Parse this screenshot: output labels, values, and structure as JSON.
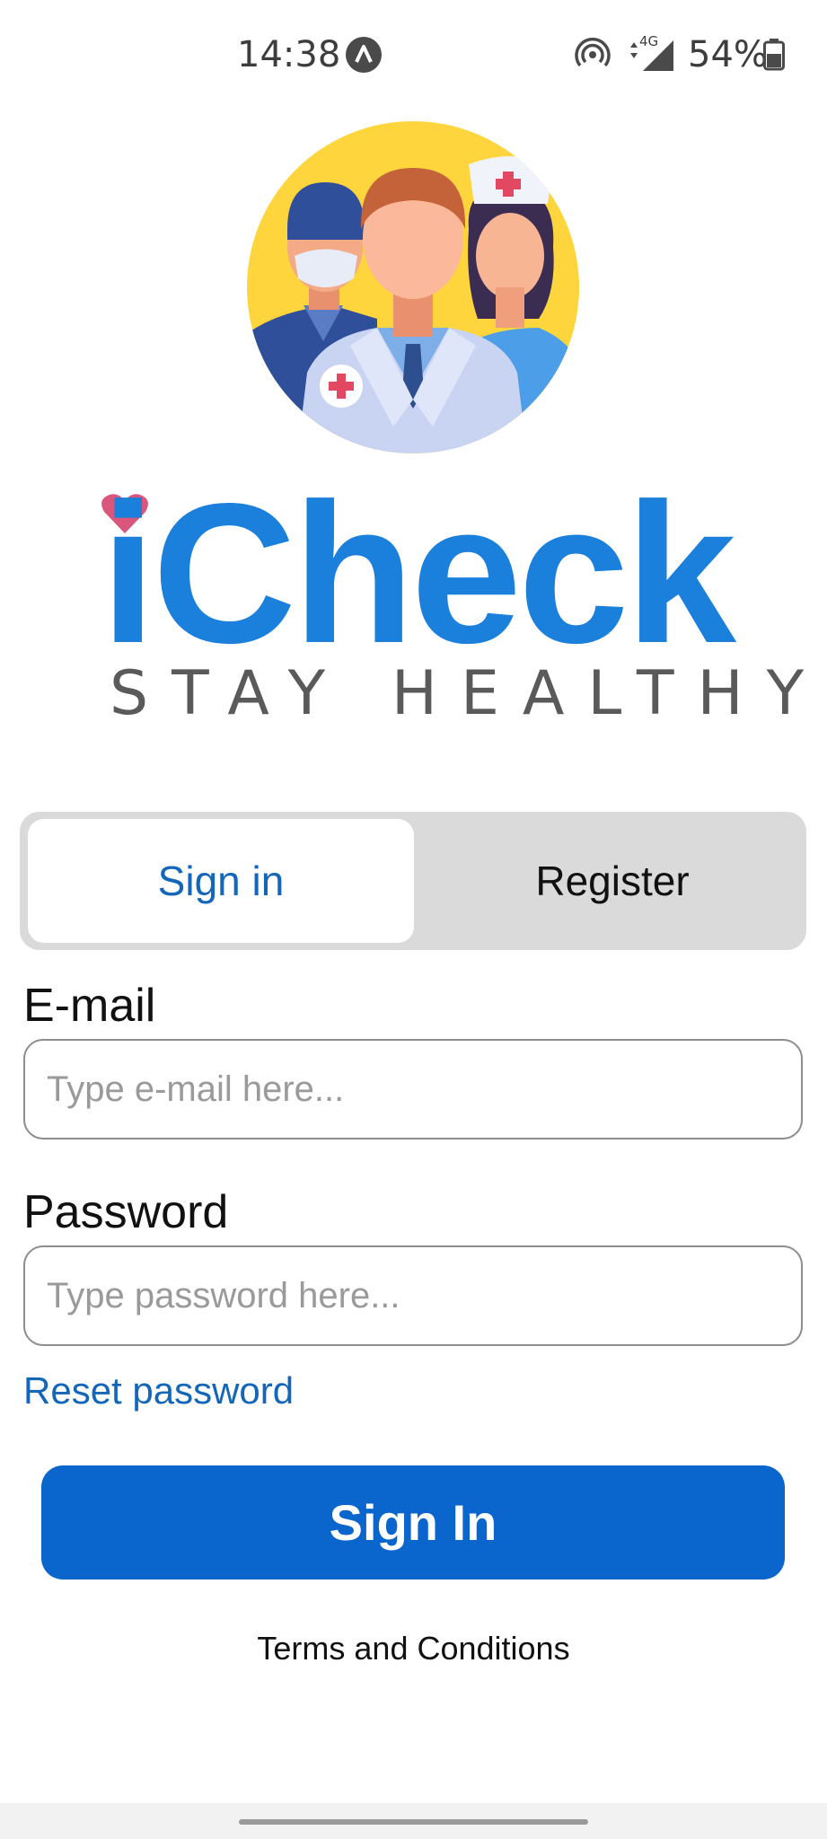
{
  "status_bar": {
    "time": "14:38",
    "notification_icon": "navigation-arrow-icon",
    "icons": [
      "hotspot-icon",
      "4g-signal-icon",
      "battery-icon"
    ],
    "network_label": "4G",
    "battery": "54%"
  },
  "brand": {
    "name": "iCheck",
    "tagline": "STAY HEALTHY",
    "colors": {
      "primary": "#1b7fdc",
      "heart": "#d9577d",
      "tagline": "#5a5a5a"
    }
  },
  "auth_tabs": {
    "signin_label": "Sign in",
    "register_label": "Register",
    "active": "signin"
  },
  "form": {
    "email_label": "E-mail",
    "email_placeholder": "Type e-mail here...",
    "email_value": "",
    "password_label": "Password",
    "password_placeholder": "Type password here...",
    "password_value": "",
    "reset_label": "Reset password",
    "submit_label": "Sign In"
  },
  "footer": {
    "terms_label": "Terms and Conditions"
  },
  "colors": {
    "accent": "#0a66cc",
    "link": "#1466b8",
    "segment_bg": "#dadada"
  }
}
